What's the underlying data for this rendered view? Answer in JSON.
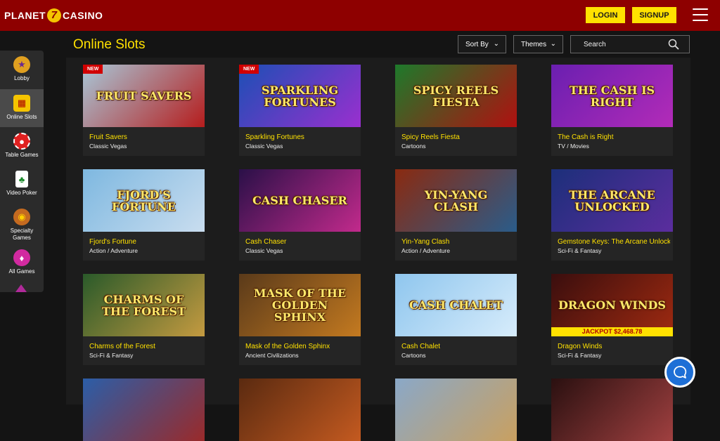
{
  "header": {
    "logo_left": "PLANET",
    "logo_mark": "7",
    "logo_right": "CASINO",
    "login_label": "LOGIN",
    "signup_label": "SIGNUP"
  },
  "page": {
    "title": "Online Slots"
  },
  "filters": {
    "sort_label": "Sort By",
    "themes_label": "Themes",
    "search_placeholder": "Search"
  },
  "sidebar": {
    "items": [
      {
        "label": "Lobby",
        "icon": "lobby-icon"
      },
      {
        "label": "Online Slots",
        "icon": "slot-machine-icon"
      },
      {
        "label": "Table Games",
        "icon": "poker-chip-icon"
      },
      {
        "label": "Video Poker",
        "icon": "playing-cards-icon"
      },
      {
        "label": "Specialty Games",
        "icon": "bowl-icon"
      },
      {
        "label": "All Games",
        "icon": "gems-icon"
      }
    ]
  },
  "games": [
    {
      "name": "Fruit Savers",
      "category": "Classic Vegas",
      "badge": "NEW",
      "art_text": "FRUIT SAVERS",
      "bg1": "#a8c7d8",
      "bg2": "#b51d1d"
    },
    {
      "name": "Sparkling Fortunes",
      "category": "Classic Vegas",
      "badge": "NEW",
      "art_text": "SPARKLING FORTUNES",
      "bg1": "#1c4fb5",
      "bg2": "#9a2fcf"
    },
    {
      "name": "Spicy Reels Fiesta",
      "category": "Cartoons",
      "art_text": "SPICY REELS FIESTA",
      "bg1": "#1d7a2b",
      "bg2": "#b01010"
    },
    {
      "name": "The Cash is Right",
      "category": "TV / Movies",
      "art_text": "THE CASH IS RIGHT",
      "bg1": "#6a1fb0",
      "bg2": "#b32bb8"
    },
    {
      "name": "Fjord's Fortune",
      "category": "Action / Adventure",
      "art_text": "FJORD'S FORTUNE",
      "bg1": "#7eb8e0",
      "bg2": "#c9ddef"
    },
    {
      "name": "Cash Chaser",
      "category": "Classic Vegas",
      "art_text": "CASH CHASER",
      "bg1": "#2a1048",
      "bg2": "#c22a8c"
    },
    {
      "name": "Yin-Yang Clash",
      "category": "Action / Adventure",
      "art_text": "YIN-YANG CLASH",
      "bg1": "#8a2a10",
      "bg2": "#2a5c8a"
    },
    {
      "name": "Gemstone Keys: The Arcane Unlocked",
      "category": "Sci-Fi & Fantasy",
      "art_text": "THE ARCANE UNLOCKED",
      "bg1": "#1c2f7a",
      "bg2": "#5b2d9e"
    },
    {
      "name": "Charms of the Forest",
      "category": "Sci-Fi & Fantasy",
      "art_text": "CHARMS OF THE FOREST",
      "bg1": "#2a5a2a",
      "bg2": "#c49a40"
    },
    {
      "name": "Mask of the Golden Sphinx",
      "category": "Ancient Civilizations",
      "art_text": "MASK OF THE GOLDEN SPHINX",
      "bg1": "#5a3a1a",
      "bg2": "#c47a20"
    },
    {
      "name": "Cash Chalet",
      "category": "Cartoons",
      "art_text": "CASH CHALET",
      "bg1": "#8fc6ee",
      "bg2": "#d7ecfb"
    },
    {
      "name": "Dragon Winds",
      "category": "Sci-Fi & Fantasy",
      "art_text": "DRAGON WINDS",
      "jackpot": "JACKPOT $2,468.78",
      "bg1": "#3a0e0e",
      "bg2": "#a02a10"
    },
    {
      "name": "",
      "category": "",
      "art_text": "",
      "bg1": "#2b5ea8",
      "bg2": "#9a2a2a"
    },
    {
      "name": "",
      "category": "",
      "art_text": "",
      "bg1": "#5a2a10",
      "bg2": "#c45a20"
    },
    {
      "name": "",
      "category": "",
      "art_text": "",
      "bg1": "#8aa8c8",
      "bg2": "#c9a060"
    },
    {
      "name": "",
      "category": "",
      "art_text": "",
      "bg1": "#2a1010",
      "bg2": "#a04040"
    }
  ],
  "colors": {
    "header_bg": "#8e0000",
    "accent_yellow": "#ffe100",
    "new_badge": "#d10000",
    "chat_blue": "#1e6fd6"
  }
}
